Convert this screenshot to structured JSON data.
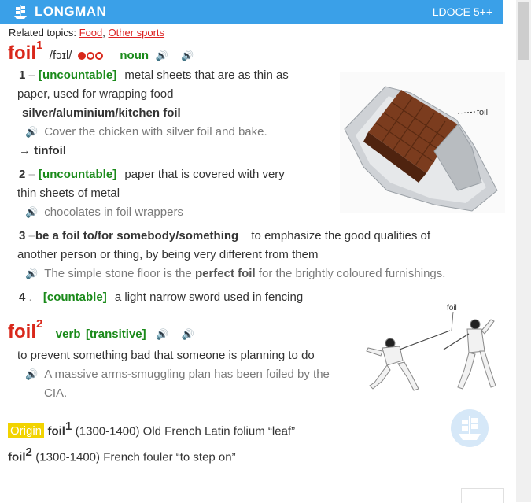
{
  "header": {
    "brand": "LONGMAN",
    "edition": "LDOCE 5++"
  },
  "related": {
    "label": "Related topics:",
    "topics": [
      "Food",
      "Other sports"
    ],
    "sep": ","
  },
  "entry1": {
    "headword": "foil",
    "homnum": "1",
    "pron": "/fɔɪl/",
    "pos": "noun",
    "senses": [
      {
        "num": "1",
        "gram": "[uncountable]",
        "def_l1": "metal sheets that are as thin as",
        "def_l2": "paper, used for wrapping food",
        "collocation": "silver/aluminium/kitchen foil",
        "example": "Cover the chicken with silver foil and bake.",
        "xref": "→ tinfoil"
      },
      {
        "num": "2",
        "gram": "[uncountable]",
        "def_l1": "paper that is covered with very",
        "def_l2": "thin sheets of metal",
        "example": "chocolates in foil wrappers"
      },
      {
        "num": "3",
        "phrase": "be a foil to/for somebody/something",
        "def_l1": "to emphasize the good qualities of",
        "def_l2": "another person or thing, by being very different from them",
        "example_pre": "The simple stone floor is the ",
        "example_bold": "perfect foil",
        "example_post": " for the brightly coloured furnishings."
      },
      {
        "num": "4",
        "gram": "[countable]",
        "def_l1": "a light narrow sword used in fencing"
      }
    ]
  },
  "entry2": {
    "headword": "foil",
    "homnum": "2",
    "pos": "verb",
    "gram": "[transitive]",
    "def": "to prevent something bad that someone is planning to do",
    "example_l1": "A massive arms-smuggling plan has been foiled by the",
    "example_l2": "CIA."
  },
  "origin": {
    "badge": "Origin",
    "line1_word": "foil",
    "line1_num": "1",
    "line1_text": "(1300-1400) Old French Latin folium “leaf”",
    "line2_word": "foil",
    "line2_num": "2",
    "line2_text": "(1300-1400) French fouler “to step on”"
  },
  "images": {
    "chocolate_label": "foil",
    "fencing_label": "foil"
  },
  "colors": {
    "header": "#3aa0e8",
    "headword": "#d9281b",
    "grammar": "#1a8a1a",
    "origin": "#f2d300"
  }
}
